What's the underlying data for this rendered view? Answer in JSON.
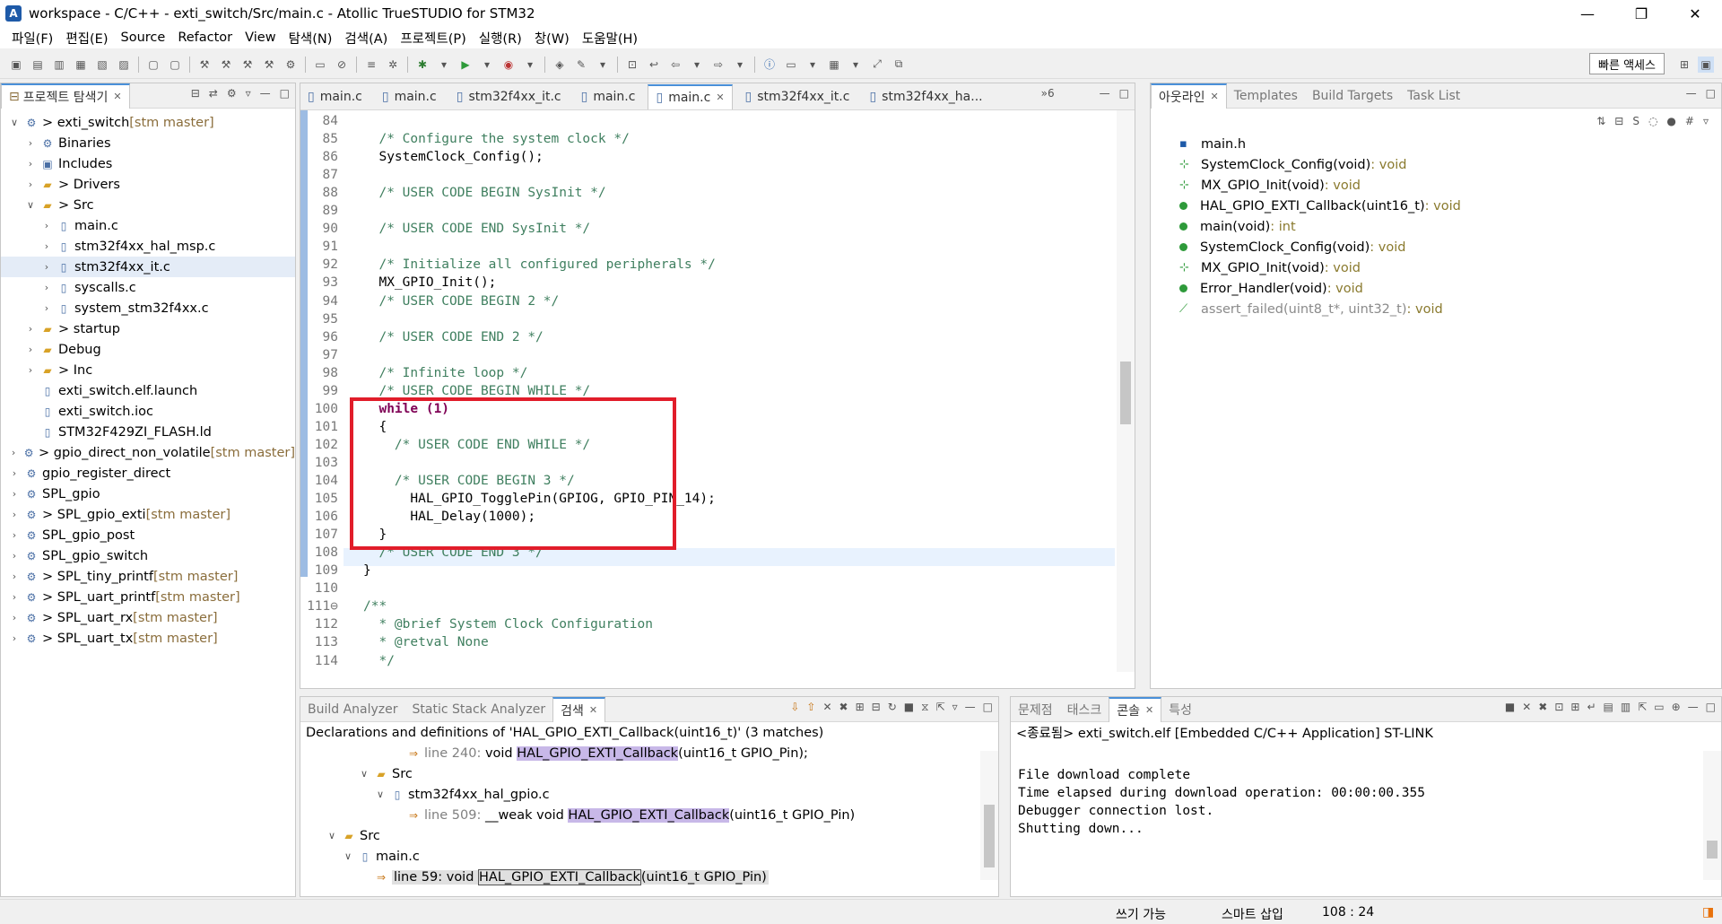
{
  "window": {
    "title": "workspace - C/C++ - exti_switch/Src/main.c - Atollic TrueSTUDIO for STM32",
    "app_icon": "A",
    "controls": [
      "—",
      "❐",
      "✕"
    ]
  },
  "menu": [
    "파일(F)",
    "편집(E)",
    "Source",
    "Refactor",
    "View",
    "탐색(N)",
    "검색(A)",
    "프로젝트(P)",
    "실행(R)",
    "창(W)",
    "도움말(H)"
  ],
  "toolbar": {
    "quick_access": "빠른 액세스"
  },
  "explorer": {
    "title": "프로젝트 탐색기",
    "items": [
      {
        "indent": 0,
        "tw": "∨",
        "icon": "project-icon",
        "label": "> exti_switch",
        "git": " [stm master]"
      },
      {
        "indent": 1,
        "tw": "›",
        "icon": "binaries-icon",
        "label": "Binaries",
        "git": ""
      },
      {
        "indent": 1,
        "tw": "›",
        "icon": "includes-icon",
        "label": "Includes",
        "git": ""
      },
      {
        "indent": 1,
        "tw": "›",
        "icon": "folder-icon",
        "label": "> Drivers",
        "git": ""
      },
      {
        "indent": 1,
        "tw": "∨",
        "icon": "folder-icon",
        "label": "> Src",
        "git": ""
      },
      {
        "indent": 2,
        "tw": "›",
        "icon": "c-file-icon",
        "label": "main.c",
        "git": ""
      },
      {
        "indent": 2,
        "tw": "›",
        "icon": "c-file-icon",
        "label": "stm32f4xx_hal_msp.c",
        "git": ""
      },
      {
        "indent": 2,
        "tw": "›",
        "icon": "c-file-icon",
        "label": "stm32f4xx_it.c",
        "git": "",
        "selected": true
      },
      {
        "indent": 2,
        "tw": "›",
        "icon": "c-file-icon",
        "label": "syscalls.c",
        "git": ""
      },
      {
        "indent": 2,
        "tw": "›",
        "icon": "c-file-icon",
        "label": "system_stm32f4xx.c",
        "git": ""
      },
      {
        "indent": 1,
        "tw": "›",
        "icon": "folder-icon",
        "label": "> startup",
        "git": ""
      },
      {
        "indent": 1,
        "tw": "›",
        "icon": "folder-icon",
        "label": "Debug",
        "git": ""
      },
      {
        "indent": 1,
        "tw": "›",
        "icon": "folder-icon",
        "label": "> Inc",
        "git": ""
      },
      {
        "indent": 1,
        "tw": "",
        "icon": "file-icon",
        "label": "exti_switch.elf.launch",
        "git": ""
      },
      {
        "indent": 1,
        "tw": "",
        "icon": "file-icon",
        "label": "exti_switch.ioc",
        "git": ""
      },
      {
        "indent": 1,
        "tw": "",
        "icon": "file-icon",
        "label": "STM32F429ZI_FLASH.ld",
        "git": ""
      },
      {
        "indent": 0,
        "tw": "›",
        "icon": "project-icon",
        "label": "> gpio_direct_non_volatile",
        "git": " [stm master]"
      },
      {
        "indent": 0,
        "tw": "›",
        "icon": "project-icon",
        "label": "gpio_register_direct",
        "git": ""
      },
      {
        "indent": 0,
        "tw": "›",
        "icon": "project-icon",
        "label": "SPL_gpio",
        "git": ""
      },
      {
        "indent": 0,
        "tw": "›",
        "icon": "project-icon",
        "label": "> SPL_gpio_exti",
        "git": " [stm master]"
      },
      {
        "indent": 0,
        "tw": "›",
        "icon": "project-icon",
        "label": "SPL_gpio_post",
        "git": ""
      },
      {
        "indent": 0,
        "tw": "›",
        "icon": "project-icon",
        "label": "SPL_gpio_switch",
        "git": ""
      },
      {
        "indent": 0,
        "tw": "›",
        "icon": "project-icon",
        "label": "> SPL_tiny_printf",
        "git": " [stm master]"
      },
      {
        "indent": 0,
        "tw": "›",
        "icon": "project-icon",
        "label": "> SPL_uart_printf",
        "git": " [stm master]"
      },
      {
        "indent": 0,
        "tw": "›",
        "icon": "project-icon",
        "label": "> SPL_uart_rx",
        "git": " [stm master]"
      },
      {
        "indent": 0,
        "tw": "›",
        "icon": "project-icon",
        "label": "> SPL_uart_tx",
        "git": " [stm master]"
      }
    ]
  },
  "editor": {
    "tabs": [
      "main.c",
      "main.c",
      "stm32f4xx_it.c",
      "main.c",
      "main.c",
      "stm32f4xx_it.c",
      "stm32f4xx_ha..."
    ],
    "active_tab": 4,
    "overflow": "»6",
    "lines": [
      {
        "n": "84",
        "t": "",
        "c": "plain"
      },
      {
        "n": "85",
        "t": "  /* Configure the system clock */",
        "c": "cm"
      },
      {
        "n": "86",
        "t": "  SystemClock_Config();",
        "c": "plain"
      },
      {
        "n": "87",
        "t": "",
        "c": "plain"
      },
      {
        "n": "88",
        "t": "  /* USER CODE BEGIN SysInit */",
        "c": "cm"
      },
      {
        "n": "89",
        "t": "",
        "c": "plain"
      },
      {
        "n": "90",
        "t": "  /* USER CODE END SysInit */",
        "c": "cm"
      },
      {
        "n": "91",
        "t": "",
        "c": "plain"
      },
      {
        "n": "92",
        "t": "  /* Initialize all configured peripherals */",
        "c": "cm"
      },
      {
        "n": "93",
        "t": "  MX_GPIO_Init();",
        "c": "plain"
      },
      {
        "n": "94",
        "t": "  /* USER CODE BEGIN 2 */",
        "c": "cm"
      },
      {
        "n": "95",
        "t": "",
        "c": "plain"
      },
      {
        "n": "96",
        "t": "  /* USER CODE END 2 */",
        "c": "cm"
      },
      {
        "n": "97",
        "t": "",
        "c": "plain"
      },
      {
        "n": "98",
        "t": "  /* Infinite loop */",
        "c": "cm"
      },
      {
        "n": "99",
        "t": "  /* USER CODE BEGIN WHILE */",
        "c": "cm"
      },
      {
        "n": "100",
        "t": "  while (1)",
        "c": "kw"
      },
      {
        "n": "101",
        "t": "  {",
        "c": "plain"
      },
      {
        "n": "102",
        "t": "    /* USER CODE END WHILE */",
        "c": "cm"
      },
      {
        "n": "103",
        "t": "",
        "c": "plain"
      },
      {
        "n": "104",
        "t": "    /* USER CODE BEGIN 3 */",
        "c": "cm"
      },
      {
        "n": "105",
        "t": "      HAL_GPIO_TogglePin(GPIOG, GPIO_PIN_14);",
        "c": "plain"
      },
      {
        "n": "106",
        "t": "      HAL_Delay(1000);",
        "c": "plain"
      },
      {
        "n": "107",
        "t": "  }",
        "c": "plain"
      },
      {
        "n": "108",
        "t": "  /* USER CODE END 3 */",
        "c": "cm"
      },
      {
        "n": "109",
        "t": "}",
        "c": "plain"
      },
      {
        "n": "110",
        "t": "",
        "c": "plain"
      },
      {
        "n": "111⊖",
        "t": "/**",
        "c": "cm"
      },
      {
        "n": "112",
        "t": "  * @brief System Clock Configuration",
        "c": "cm"
      },
      {
        "n": "113",
        "t": "  * @retval None",
        "c": "cm"
      },
      {
        "n": "114",
        "t": "  */",
        "c": "cm"
      }
    ]
  },
  "outline": {
    "tabs": [
      "아웃라인",
      "Templates",
      "Build Targets",
      "Task List"
    ],
    "items": [
      {
        "icon": "include-icon",
        "name": "main.h",
        "type": ""
      },
      {
        "icon": "declaration-icon",
        "name": "SystemClock_Config(void)",
        "type": " : void"
      },
      {
        "icon": "static-declaration-icon",
        "name": "MX_GPIO_Init(void)",
        "type": " : void"
      },
      {
        "icon": "function-icon",
        "name": "HAL_GPIO_EXTI_Callback(uint16_t)",
        "type": " : void"
      },
      {
        "icon": "function-icon",
        "name": "main(void)",
        "type": " : int"
      },
      {
        "icon": "function-icon",
        "name": "SystemClock_Config(void)",
        "type": " : void"
      },
      {
        "icon": "static-function-icon",
        "name": "MX_GPIO_Init(void)",
        "type": " : void"
      },
      {
        "icon": "function-icon",
        "name": "Error_Handler(void)",
        "type": " : void"
      },
      {
        "icon": "macro-icon",
        "name": "assert_failed(uint8_t*, uint32_t)",
        "type": " : void",
        "dim": true
      }
    ]
  },
  "search": {
    "tabs": [
      "Build Analyzer",
      "Static Stack Analyzer",
      "검색"
    ],
    "summary": "Declarations and definitions of 'HAL_GPIO_EXTI_Callback(uint16_t)' (3 matches)",
    "rows": [
      {
        "indent": 5,
        "tw": "",
        "icon": "match-icon",
        "pre": "line 240:",
        "mid": "void ",
        "hit": "HAL_GPIO_EXTI_Callback",
        "post": "(uint16_t GPIO_Pin);"
      },
      {
        "indent": 3,
        "tw": "∨",
        "icon": "folder-icon",
        "pre": "",
        "mid": "Src",
        "hit": "",
        "post": ""
      },
      {
        "indent": 4,
        "tw": "∨",
        "icon": "c-file-icon",
        "pre": "",
        "mid": "stm32f4xx_hal_gpio.c",
        "hit": "",
        "post": ""
      },
      {
        "indent": 5,
        "tw": "",
        "icon": "match-icon",
        "pre": "line 509:",
        "mid": "__weak void ",
        "hit": "HAL_GPIO_EXTI_Callback",
        "post": "(uint16_t GPIO_Pin)"
      },
      {
        "indent": 1,
        "tw": "∨",
        "icon": "folder-icon",
        "pre": "",
        "mid": "Src",
        "hit": "",
        "post": ""
      },
      {
        "indent": 2,
        "tw": "∨",
        "icon": "c-file-icon",
        "pre": "",
        "mid": "main.c",
        "hit": "",
        "post": ""
      },
      {
        "indent": 3,
        "tw": "",
        "icon": "match-icon",
        "pre": "line 59:",
        "mid": "void ",
        "hit": "HAL_GPIO_EXTI_Callback",
        "post": "(uint16_t GPIO_Pin)",
        "selected": true
      }
    ]
  },
  "console": {
    "tabs": [
      "문제점",
      "태스크",
      "콘솔",
      "특성"
    ],
    "header": "<종료됨> exti_switch.elf [Embedded C/C++ Application] ST-LINK",
    "lines": [
      "",
      "File download complete",
      "Time elapsed during download operation: 00:00:00.355",
      "Debugger connection lost.",
      "Shutting down..."
    ]
  },
  "status": {
    "writable": "쓰기 가능",
    "insert": "스마트 삽입",
    "position": "108 : 24"
  }
}
